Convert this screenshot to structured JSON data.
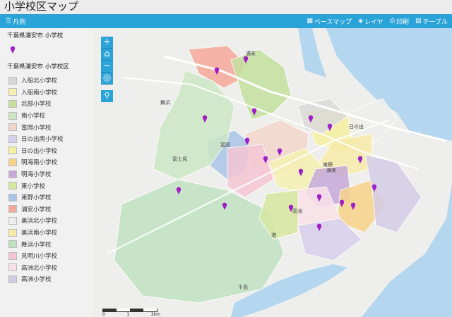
{
  "app": {
    "title": "小学校区マップ"
  },
  "toolbar": {
    "legend_label": "凡例",
    "basemap_label": "ベースマップ",
    "layer_label": "レイヤ",
    "print_label": "印刷",
    "table_label": "テーブル"
  },
  "legend": {
    "schools_title": "千葉県浦安市 小学校",
    "districts_title": "千葉県浦安市 小学校区",
    "pin_color": "#a020c8",
    "items": [
      {
        "label": "入船北小学校",
        "color": "#d9d9d9"
      },
      {
        "label": "入船南小学校",
        "color": "#f5f0b0"
      },
      {
        "label": "北部小学校",
        "color": "#c3e0a0"
      },
      {
        "label": "南小学校",
        "color": "#cde6c4"
      },
      {
        "label": "富岡小学校",
        "color": "#f2d6cc"
      },
      {
        "label": "日の出南小学校",
        "color": "#d6d0ec"
      },
      {
        "label": "日の出小学校",
        "color": "#f5f0a0"
      },
      {
        "label": "明海南小学校",
        "color": "#f7d28a"
      },
      {
        "label": "明海小学校",
        "color": "#c6a8d8"
      },
      {
        "label": "東小学校",
        "color": "#d6e8a0"
      },
      {
        "label": "東野小学校",
        "color": "#a8c4e6"
      },
      {
        "label": "浦安小学校",
        "color": "#f4a89a"
      },
      {
        "label": "美浜北小学校",
        "color": "#ededed"
      },
      {
        "label": "美浜南小学校",
        "color": "#f7eaa8"
      },
      {
        "label": "舞浜小学校",
        "color": "#bfe2c2"
      },
      {
        "label": "見明川小学校",
        "color": "#f4c6d4"
      },
      {
        "label": "高洲北小学校",
        "color": "#f8e0e8"
      },
      {
        "label": "高洲小学校",
        "color": "#d2cce6"
      }
    ]
  },
  "map": {
    "labels": {
      "urayasu": "浦安",
      "maihama": "舞浜",
      "tomioka": "富岡",
      "takasu": "高洲",
      "minato": "港",
      "chidori": "千鳥",
      "fujimi": "富士見",
      "hinode": "日の出",
      "higashino": "東野",
      "kaigan": "海楽"
    },
    "scale": {
      "zero": "0",
      "mid": "1",
      "max": "2km"
    },
    "colors": {
      "water": "#b5d6ef",
      "land": "#eeeeec",
      "road": "#ffffff"
    }
  }
}
